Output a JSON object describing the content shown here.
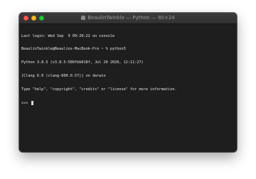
{
  "window": {
    "title": "BeaulinTwinkle — Python — 80×24",
    "title_icon": "home-folder-icon"
  },
  "terminal": {
    "lines": [
      "Last login: Wed Sep  9 09:20:22 on console",
      "BeaulinTwinkle@Beaulins-MacBook-Pro ~ % python3",
      "Python 3.8.5 (v3.8.5:580fbb018f, Jul 20 2020, 12:11:27)",
      "[Clang 6.0 (clang-600.0.57)] on darwin",
      "Type \"help\", \"copyright\", \"credits\" or \"license\" for more information."
    ],
    "prompt": ">>> "
  },
  "colors": {
    "close": "#fe5f57",
    "minimize": "#febc2e",
    "zoom": "#28c840",
    "background": "#1e1e1e",
    "text": "#e6e6e6"
  }
}
